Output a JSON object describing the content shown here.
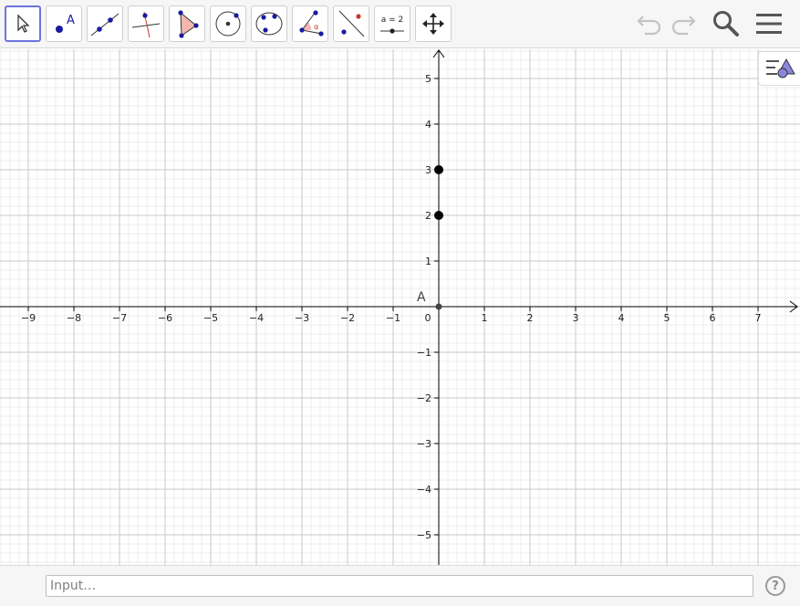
{
  "toolbar": {
    "tools": [
      {
        "name": "move-tool",
        "icon": "arrow-cursor-icon",
        "selected": true
      },
      {
        "name": "point-tool",
        "icon": "point-icon",
        "label": "A"
      },
      {
        "name": "line-tool",
        "icon": "line-through-two-points-icon"
      },
      {
        "name": "perpendicular-line-tool",
        "icon": "perpendicular-line-icon"
      },
      {
        "name": "polygon-tool",
        "icon": "polygon-icon"
      },
      {
        "name": "circle-tool",
        "icon": "circle-with-center-icon"
      },
      {
        "name": "conic-tool",
        "icon": "ellipse-icon"
      },
      {
        "name": "angle-tool",
        "icon": "angle-icon",
        "label": "α"
      },
      {
        "name": "reflect-tool",
        "icon": "reflect-about-line-icon"
      },
      {
        "name": "slider-tool",
        "icon": "slider-icon",
        "label": "a = 2"
      },
      {
        "name": "move-graphics-view-tool",
        "icon": "move-view-icon"
      }
    ],
    "undo_icon": "undo-icon",
    "redo_icon": "redo-icon",
    "search_icon": "search-icon",
    "menu_icon": "hamburger-menu-icon"
  },
  "style_bar_icon": "style-bar-toggle-icon",
  "graphics": {
    "x_axis_ticks": [
      "−9",
      "−8",
      "−7",
      "−6",
      "−5",
      "−4",
      "−3",
      "−2",
      "−1",
      "0",
      "1",
      "2",
      "3",
      "4",
      "5",
      "6",
      "7"
    ],
    "y_axis_ticks": [
      "5",
      "4",
      "3",
      "2",
      "1",
      "−1",
      "−2",
      "−3",
      "−4",
      "−5"
    ],
    "points": [
      {
        "label": "A",
        "x": 0,
        "y": 0,
        "show_label": true,
        "style": "small-gray"
      },
      {
        "label": "",
        "x": 0,
        "y": 2,
        "show_label": false,
        "style": "large-black"
      },
      {
        "label": "",
        "x": 0,
        "y": 3,
        "show_label": false,
        "style": "large-black"
      }
    ],
    "colors": {
      "major_grid": "#c8c8c8",
      "minor_grid": "#ececec",
      "axis": "#000000",
      "point": "#000000",
      "point_origin": "#444444"
    }
  },
  "input_bar": {
    "placeholder": "Input…",
    "help_label": "?"
  }
}
